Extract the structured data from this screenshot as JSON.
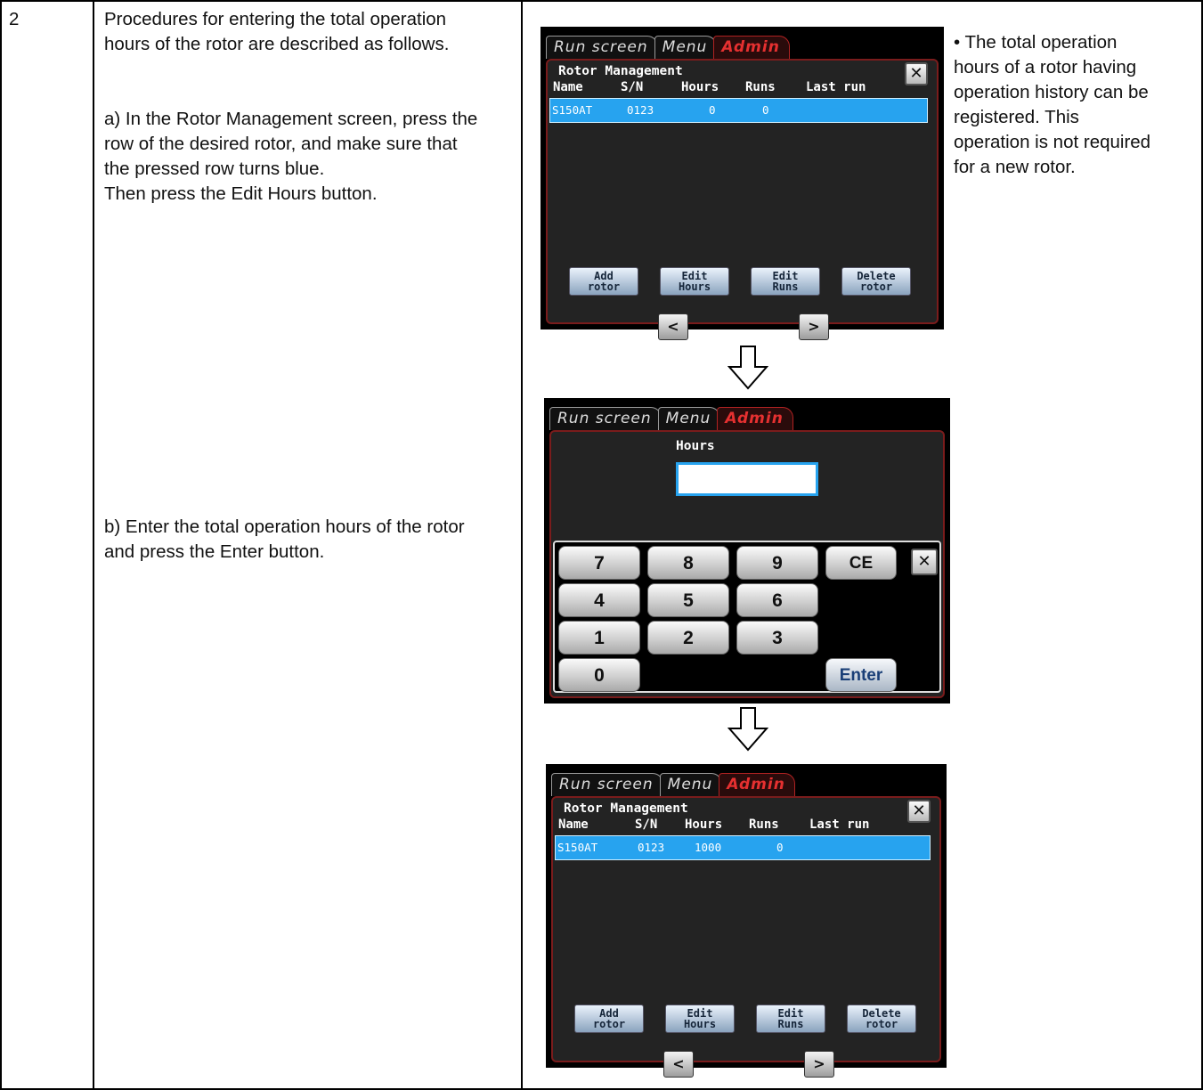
{
  "step_number": "2",
  "left_column": {
    "intro": "Procedures for entering the total operation\nhours of the rotor are described as follows.",
    "step_a": "a) In the Rotor Management screen, press the\nrow of the desired rotor, and make sure that\nthe pressed row turns blue.\nThen press the Edit Hours button.",
    "step_b": "b) Enter the total operation hours of the rotor\nand press the Enter button."
  },
  "note": "• The total operation\nhours of a rotor having\noperation history can be\nregistered. This\noperation is not required\nfor a new rotor.",
  "tabs": [
    "Run screen",
    "Menu",
    "Admin"
  ],
  "rotor_screen_1": {
    "title": "Rotor Management",
    "close": "✕",
    "columns": [
      "Name",
      "S/N",
      "Hours",
      "Runs",
      "Last run"
    ],
    "row": {
      "name": "S150AT",
      "sn": "0123",
      "hours": "0",
      "runs": "0",
      "last_run": ""
    },
    "buttons": [
      "Add\nrotor",
      "Edit\nHours",
      "Edit\nRuns",
      "Delete\nrotor"
    ],
    "prev": "<",
    "next": ">"
  },
  "keypad_screen": {
    "label": "Hours",
    "input_value": "",
    "keys": [
      "7",
      "8",
      "9",
      "4",
      "5",
      "6",
      "1",
      "2",
      "3",
      "0"
    ],
    "ce": "CE",
    "close": "✕",
    "enter": "Enter"
  },
  "rotor_screen_2": {
    "title": "Rotor Management",
    "close": "✕",
    "columns": [
      "Name",
      "S/N",
      "Hours",
      "Runs",
      "Last run"
    ],
    "row": {
      "name": "S150AT",
      "sn": "0123",
      "hours": "1000",
      "runs": "0",
      "last_run": ""
    },
    "buttons": [
      "Add\nrotor",
      "Edit\nHours",
      "Edit\nRuns",
      "Delete\nrotor"
    ],
    "prev": "<",
    "next": ">"
  },
  "colors": {
    "selected_row": "#27a3ef",
    "admin_tab": "#e53030",
    "panel_border": "#7a1c1c"
  }
}
